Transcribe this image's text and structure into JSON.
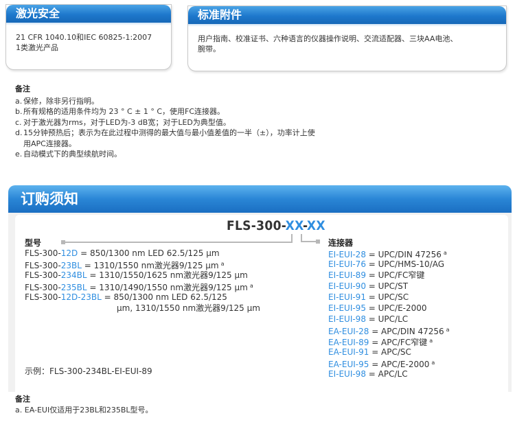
{
  "laser_box": {
    "title": "激光安全",
    "lines": [
      "21 CFR 1040.10和IEC 60825-1:2007",
      "1类激光产品"
    ]
  },
  "accessories_box": {
    "title": "标准附件",
    "lines": [
      "用户指南、校准证书、六种语言的仪器操作说明、交流适配器、三块AA电池、",
      "腕带。"
    ]
  },
  "notes": {
    "title": "备注",
    "items": [
      {
        "letter": "a.",
        "text": "保修，除非另行指明。"
      },
      {
        "letter": "b.",
        "text": "所有规格的适用条件均为 23 ° C ± 1 ° C，使用FC连接器。"
      },
      {
        "letter": "c.",
        "text": "对于激光器为rms，对于LED为-3 dB宽；对于LED为典型值。"
      },
      {
        "letter": "d.",
        "text": "15分钟预热后；表示为在此过程中测得的最大值与最小值差值的一半（±），功率计上使"
      },
      {
        "letter": "",
        "text": "用APC连接器。"
      },
      {
        "letter": "e.",
        "text": "自动模式下的典型续航时间。"
      }
    ]
  },
  "ordering": {
    "title": "订购须知",
    "part_number": {
      "prefix": "FLS-300-",
      "xx1": "XX",
      "dash": "-",
      "xx2": "XX"
    },
    "model_label": "型号",
    "connector_label": "连接器",
    "models": [
      {
        "pre": "FLS-300-",
        "code": "12D",
        "post": " = 850/1300 nm LED 62.5/125 µm",
        "mark": ""
      },
      {
        "pre": "FLS-300-",
        "code": "23BL",
        "post": " = 1310/1550 nm激光器9/125 µm",
        "mark": "a"
      },
      {
        "pre": "FLS-300-",
        "code": "234BL",
        "post": " = 1310/1550/1625 nm激光器9/125 µm",
        "mark": ""
      },
      {
        "pre": "FLS-300-",
        "code": "235BL",
        "post": " = 1310/1490/1550 nm激光器9/125 µm",
        "mark": "a"
      },
      {
        "pre": "FLS-300-",
        "code": "12D-23BL",
        "post": " = 850/1300 nm LED 62.5/125",
        "mark": ""
      },
      {
        "pre": "",
        "code": "",
        "post": "µm, 1310/1550 nm激光器9/125 µm",
        "mark": ""
      }
    ],
    "example": "示例：FLS-300-234BL-EI-EUI-89",
    "connectors": [
      {
        "code": "EI-EUI-28",
        "desc": " = UPC/DIN 47256",
        "mark": "a"
      },
      {
        "code": "EI-EUI-76",
        "desc": " = UPC/HMS-10/AG",
        "mark": ""
      },
      {
        "code": "EI-EUI-89",
        "desc": " = UPC/FC窄键",
        "mark": ""
      },
      {
        "code": "EI-EUI-90",
        "desc": " = UPC/ST",
        "mark": ""
      },
      {
        "code": "EI-EUI-91",
        "desc": " = UPC/SC",
        "mark": ""
      },
      {
        "code": "EI-EUI-95",
        "desc": " = UPC/E-2000",
        "mark": ""
      },
      {
        "code": "EI-EUI-98",
        "desc": " = UPC/LC",
        "mark": ""
      },
      {
        "code": "EA-EUI-28",
        "desc": " = APC/DIN 47256",
        "mark": "a"
      },
      {
        "code": "EA-EUI-89",
        "desc": " = APC/FC窄键",
        "mark": "a"
      },
      {
        "code": "EA-EUI-91",
        "desc": " = APC/SC",
        "mark": ""
      },
      {
        "code": "EA-EUI-95",
        "desc": " = APC/E-2000",
        "mark": "a"
      },
      {
        "code": "EI-EUI-98",
        "desc": " = APC/LC",
        "mark": ""
      }
    ]
  },
  "bottom_notes": {
    "title": "备注",
    "items": [
      {
        "letter": "a.",
        "text": "EA-EUI仅适用于23BL和235BL型号。"
      }
    ]
  },
  "colors": {
    "accent_blue": "#2f8ee0",
    "header_blue": "#1e78cc",
    "panel_gray": "#f1f1f1"
  }
}
